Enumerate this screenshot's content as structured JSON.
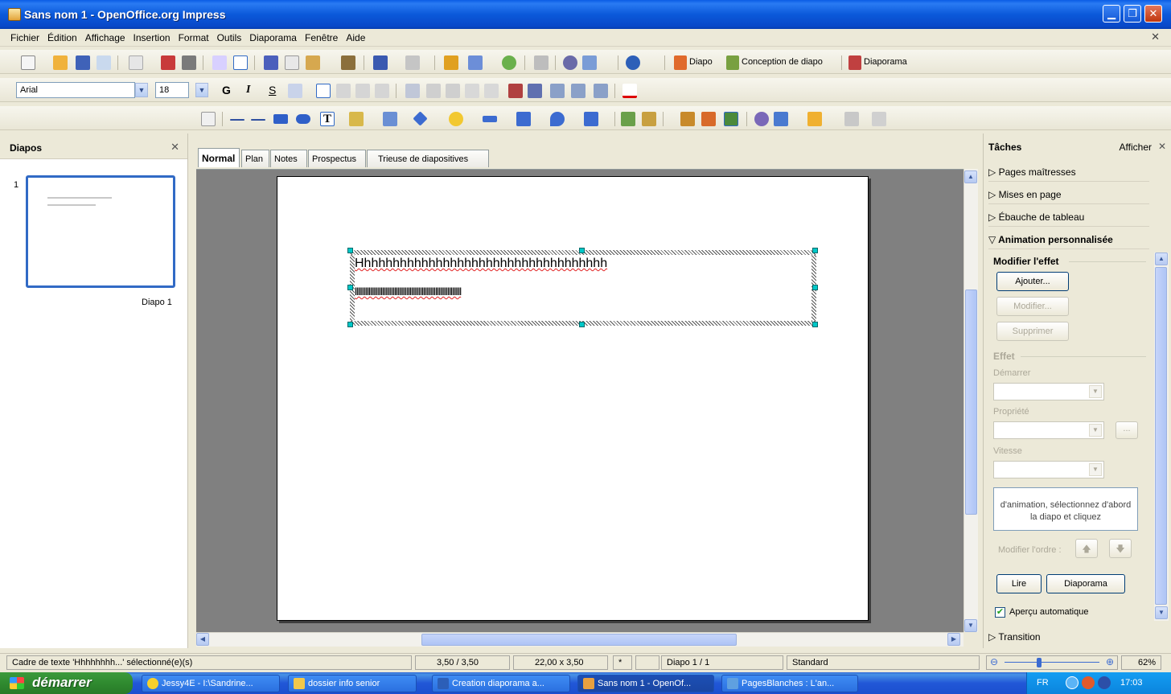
{
  "window": {
    "title": "Sans nom 1 - OpenOffice.org Impress",
    "buttons": {
      "minimize": "▁",
      "maximize": "❐",
      "close": "✕"
    }
  },
  "menu": {
    "items": [
      "Fichier",
      "Édition",
      "Affichage",
      "Insertion",
      "Format",
      "Outils",
      "Diaporama",
      "Fenêtre",
      "Aide"
    ],
    "close": "✕"
  },
  "toolbar": {
    "diapo_label": "Diapo",
    "conception_label": "Conception de diapo",
    "diaporama_label": "Diaporama"
  },
  "format": {
    "font": "Arial",
    "size": "18",
    "bold": "G",
    "italic": "I",
    "shadow": "S"
  },
  "slides_pane": {
    "title": "Diapos",
    "close": "✕",
    "thumb_number": "1",
    "thumb_label": "Diapo 1"
  },
  "tabs": [
    "Normal",
    "Plan",
    "Notes",
    "Prospectus",
    "Trieuse de diapositives"
  ],
  "slide": {
    "line1": "Hhhhhhhhhhhhhhhhhhhhhhhhhhhhhhhhhhh",
    "line2": "llllllllllllllllllllllllllllllllllllllllllllllllllllllllllllllllllllll"
  },
  "tasks": {
    "title": "Tâches",
    "afficher": "Afficher",
    "close": "✕",
    "sections": [
      "Pages maîtresses",
      "Mises en page",
      "Ébauche de tableau",
      "Animation personnalisée"
    ],
    "transition": "Transition",
    "modify_group": "Modifier l'effet",
    "add": "Ajouter...",
    "modify": "Modifier...",
    "delete": "Supprimer",
    "effect_group": "Effet",
    "start": "Démarrer",
    "property": "Propriété",
    "speed": "Vitesse",
    "info": "d'animation, sélectionnez d'abord la diapo et cliquez",
    "order": "Modifier l'ordre :",
    "play": "Lire",
    "slideshow": "Diaporama",
    "autopreview": "Aperçu automatique"
  },
  "status": {
    "selection": "Cadre de texte 'Hhhhhhhh...' sélectionné(e)(s)",
    "position": "3,50 / 3,50",
    "size": "22,00 x 3,50",
    "modified": "*",
    "page": "Diapo 1 / 1",
    "layout": "Standard",
    "zoom": "62%"
  },
  "taskbar": {
    "start": "démarrer",
    "items": [
      "Jessy4E - I:\\Sandrine...",
      "dossier info senior",
      "Creation diaporama a...",
      "Sans nom 1 - OpenOf...",
      "PagesBlanches : L'an..."
    ],
    "lang": "FR",
    "clock": "17:03"
  }
}
